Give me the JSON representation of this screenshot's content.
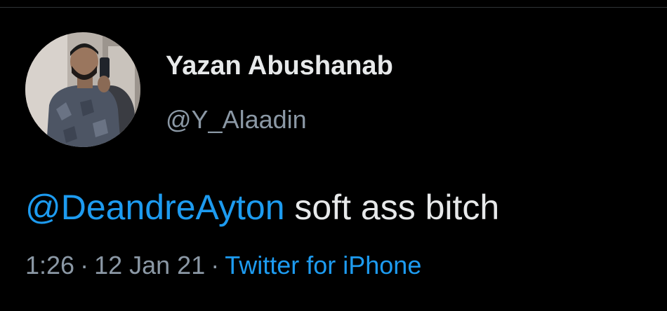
{
  "user": {
    "display_name": "Yazan Abushanab",
    "handle": "@Y_Alaadin",
    "avatar_icon": "profile-photo"
  },
  "tweet": {
    "mention": "@DeandreAyton",
    "text": "soft ass bitch"
  },
  "meta": {
    "time": "1:26",
    "separator": "·",
    "date": "12 Jan 21",
    "source": "Twitter for iPhone"
  },
  "colors": {
    "background": "#000000",
    "primary_text": "#e7e9ea",
    "secondary_text": "#8b98a5",
    "accent": "#1d9bf0"
  }
}
